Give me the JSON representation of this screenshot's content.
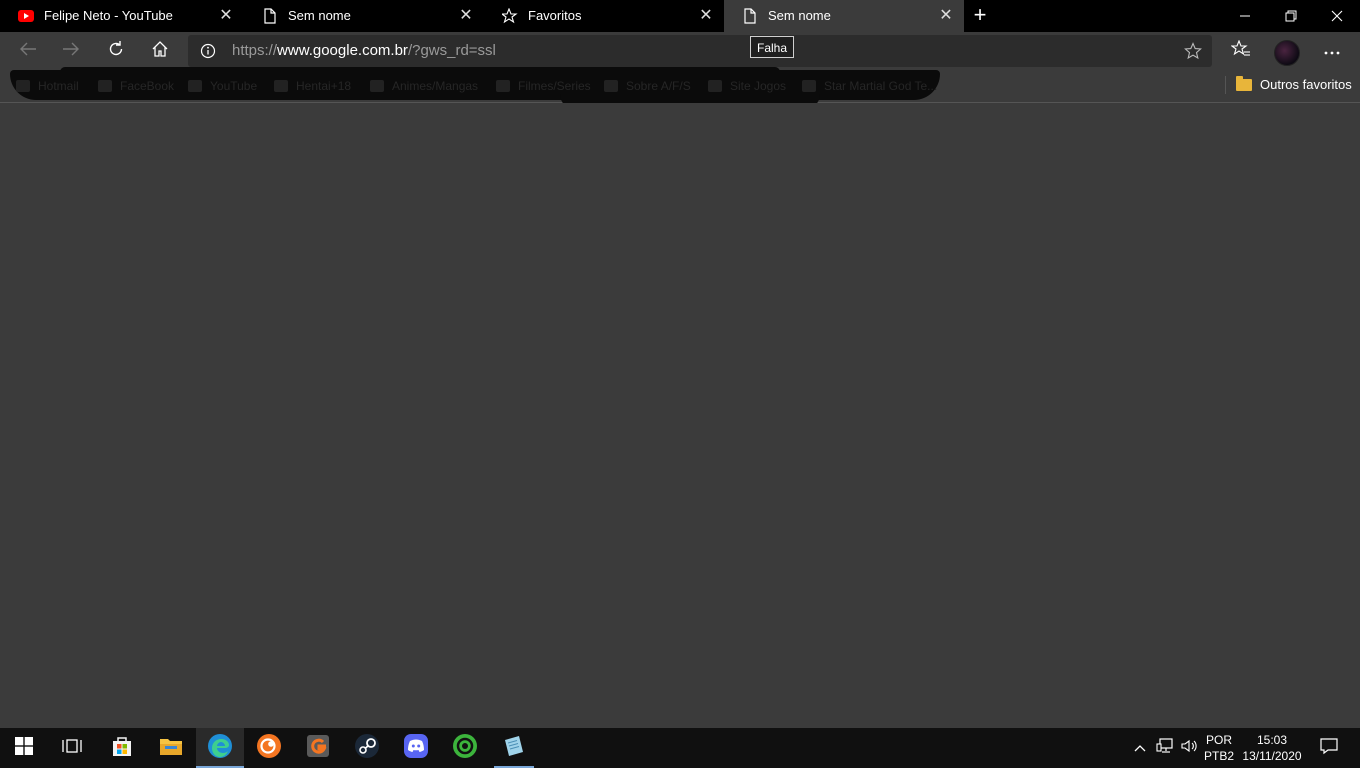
{
  "tabs": [
    {
      "title": "Felipe Neto - YouTube",
      "icon": "youtube-icon"
    },
    {
      "title": "Sem nome",
      "icon": "page-icon"
    },
    {
      "title": "Favoritos",
      "icon": "favorites-icon"
    },
    {
      "title": "Sem nome",
      "icon": "page-icon"
    }
  ],
  "address": {
    "scheme": "https://",
    "host": "www.google.com.br",
    "path": "/?gws_rd=ssl"
  },
  "tooltip": "Falha",
  "favorites_bar": {
    "items": [
      "Hotmail",
      "FaceBook",
      "YouTube",
      "Hentai+18",
      "Animes/Mangas",
      "Filmes/Series",
      "Sobre A/F/S",
      "Site Jogos",
      "Star Martial God Te..."
    ],
    "other_favorites": "Outros favoritos"
  },
  "taskbar": {
    "apps": [
      "windows-start-icon",
      "task-view-icon",
      "store-icon",
      "file-explorer-icon",
      "edge-icon",
      "crunchyroll-icon",
      "garena-icon",
      "steam-icon",
      "discord-icon",
      "green-app-icon",
      "notepad-icon"
    ],
    "language": {
      "line1": "POR",
      "line2": "PTB2"
    },
    "time": "15:03",
    "date": "13/11/2020"
  },
  "colors": {
    "accent": "#7aa7d8",
    "youtube_red": "#ff0000",
    "folder": "#e8b53a"
  }
}
